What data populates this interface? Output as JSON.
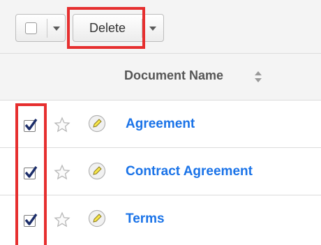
{
  "toolbar": {
    "action_label": "Delete",
    "icons": [
      "checkbox-icon",
      "caret-down-icon",
      "caret-down-icon"
    ]
  },
  "list_header": {
    "column_title": "Document Name",
    "sort_icon": "sort-icon"
  },
  "rows": [
    {
      "name": "Agreement",
      "checked": true
    },
    {
      "name": "Contract Agreement",
      "checked": true
    },
    {
      "name": "Terms",
      "checked": true
    }
  ],
  "colors": {
    "link": "#1a73e8",
    "highlight": "#e62f2f",
    "check": "#1c2e6a"
  }
}
